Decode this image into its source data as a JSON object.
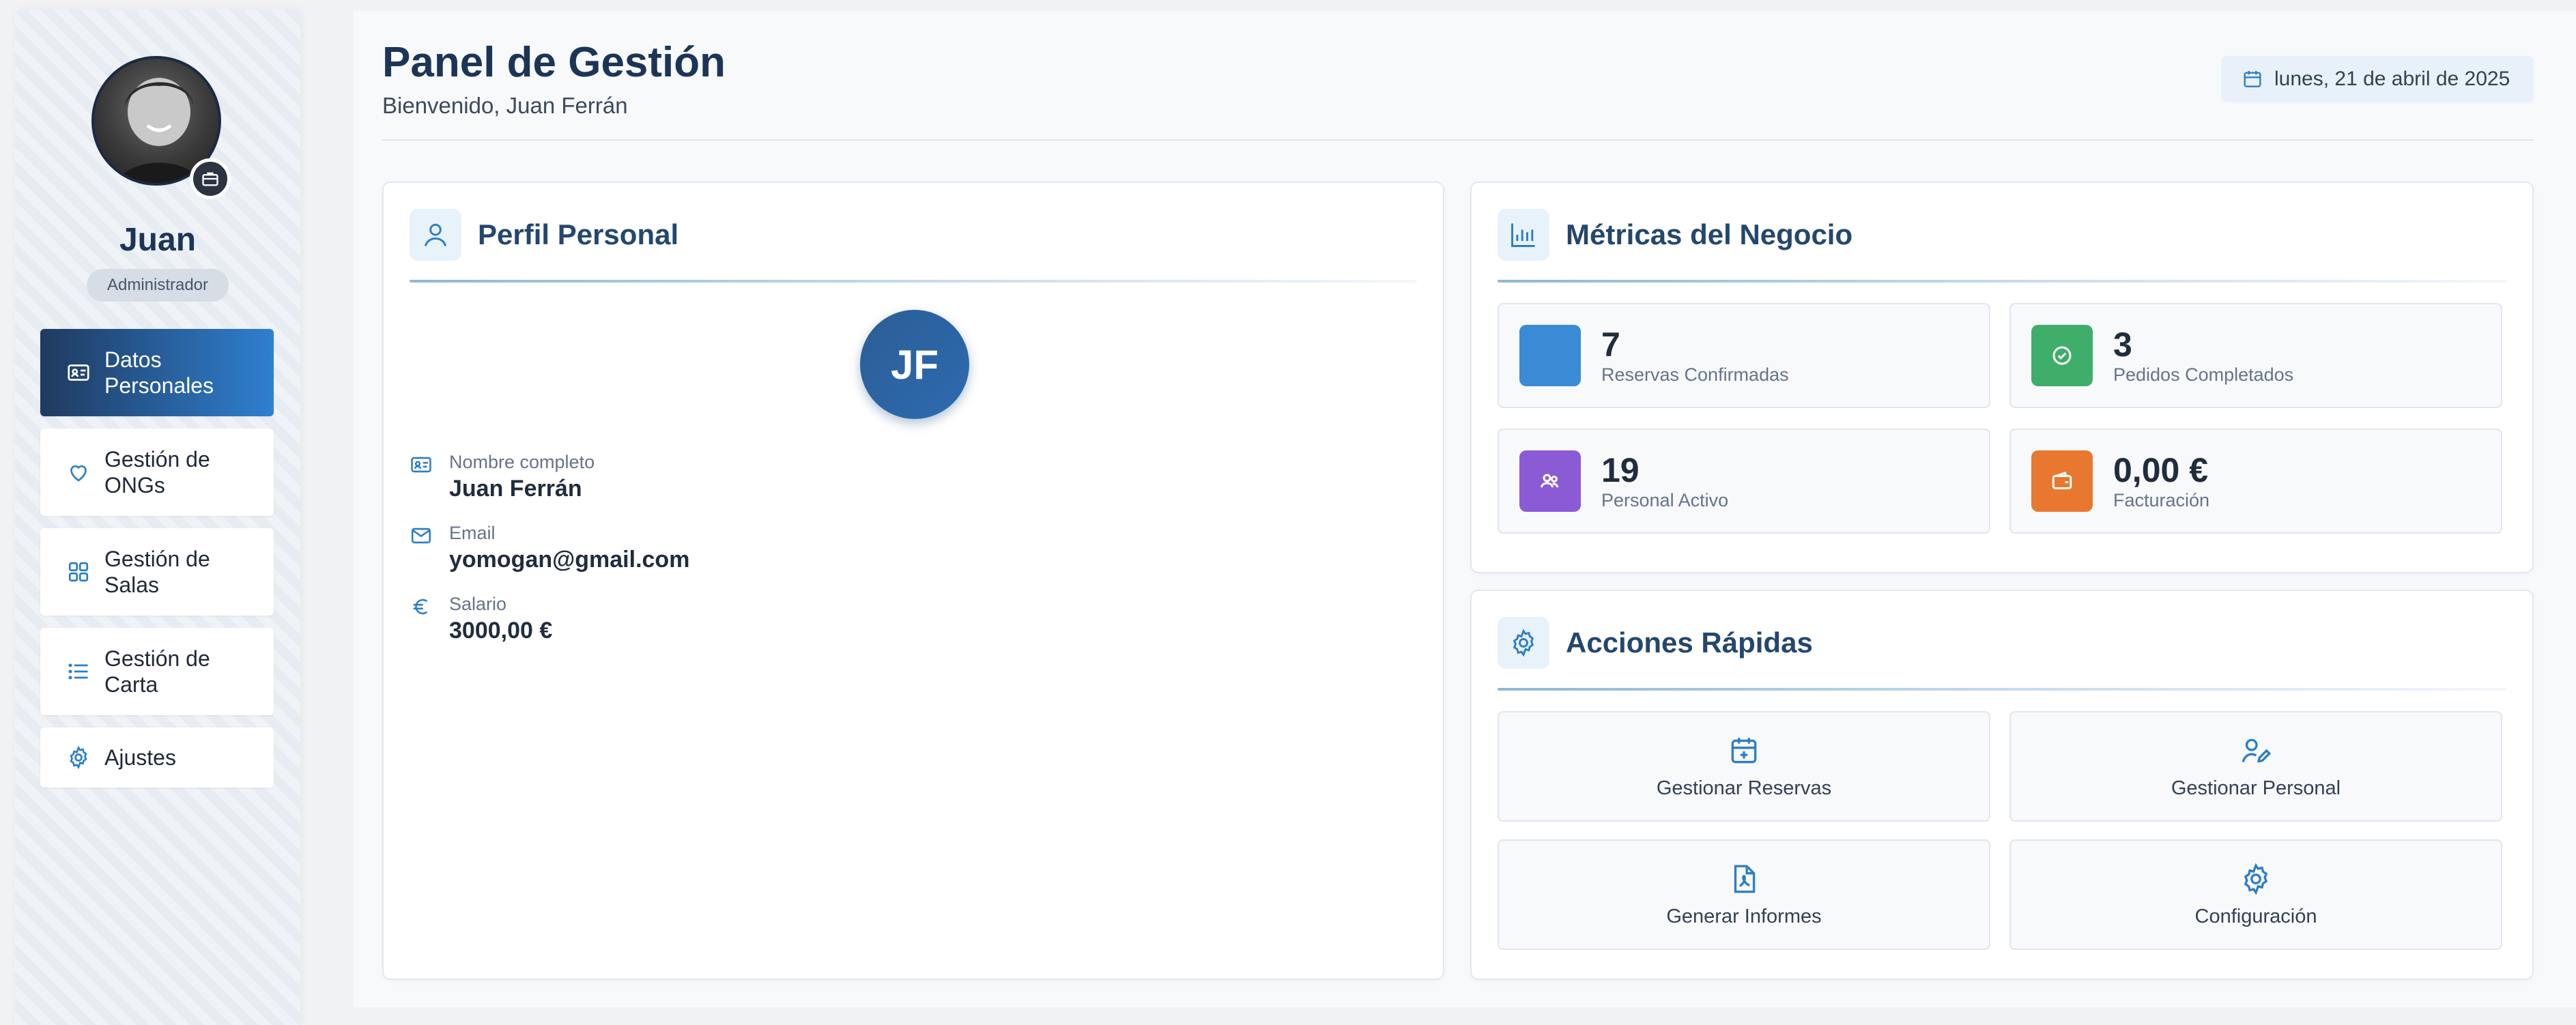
{
  "sidebar": {
    "user_name": "Juan",
    "role": "Administrador",
    "items": [
      {
        "label": "Datos Personales",
        "icon": "id-card-icon",
        "active": true
      },
      {
        "label": "Gestión de ONGs",
        "icon": "heart-icon",
        "active": false
      },
      {
        "label": "Gestión de Salas",
        "icon": "grid-icon",
        "active": false
      },
      {
        "label": "Gestión de Carta",
        "icon": "list-icon",
        "active": false
      },
      {
        "label": "Ajustes",
        "icon": "gear-icon",
        "active": false
      }
    ]
  },
  "header": {
    "title": "Panel de Gestión",
    "welcome": "Bienvenido, Juan Ferrán",
    "date": "lunes, 21 de abril de 2025"
  },
  "profile": {
    "title": "Perfil Personal",
    "initials": "JF",
    "fields": [
      {
        "label": "Nombre completo",
        "value": "Juan Ferrán",
        "icon": "id-card-icon"
      },
      {
        "label": "Email",
        "value": "yomogan@gmail.com",
        "icon": "mail-icon"
      },
      {
        "label": "Salario",
        "value": "3000,00 €",
        "icon": "euro-icon"
      }
    ]
  },
  "metrics": {
    "title": "Métricas del Negocio",
    "items": [
      {
        "value": "7",
        "label": "Reservas Confirmadas",
        "color": "#3b8ad6"
      },
      {
        "value": "3",
        "label": "Pedidos Completados",
        "color": "#3fae6a"
      },
      {
        "value": "19",
        "label": "Personal Activo",
        "color": "#8b5bd6"
      },
      {
        "value": "0,00 €",
        "label": "Facturación",
        "color": "#e8782f"
      }
    ]
  },
  "actions": {
    "title": "Acciones Rápidas",
    "items": [
      {
        "label": "Gestionar Reservas",
        "icon": "calendar-plus-icon"
      },
      {
        "label": "Gestionar Personal",
        "icon": "user-edit-icon"
      },
      {
        "label": "Generar Informes",
        "icon": "file-pdf-icon"
      },
      {
        "label": "Configuración",
        "icon": "gear-icon"
      }
    ]
  },
  "colors": {
    "accent": "#2f7fd0",
    "navy": "#1c3557",
    "icon_blue": "#2d7ec4"
  }
}
